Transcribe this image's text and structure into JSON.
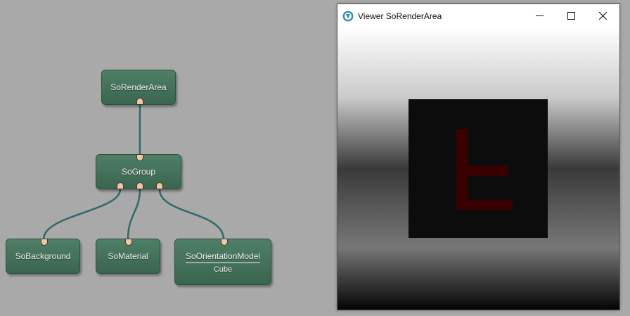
{
  "graph": {
    "nodes": {
      "render_area": {
        "label": "SoRenderArea"
      },
      "group": {
        "label": "SoGroup"
      },
      "background": {
        "label": "SoBackground"
      },
      "material": {
        "label": "SoMaterial"
      },
      "orientation_model": {
        "label": "SoOrientationModel",
        "sublabel": "Cube"
      }
    },
    "colors": {
      "node": "#44725b",
      "port": "#f3c79f",
      "wire": "#2e6a6a"
    }
  },
  "viewer": {
    "title": "Viewer SoRenderArea",
    "icons": {
      "app": "app-logo-icon",
      "minimize": "minimize-icon",
      "maximize": "maximize-icon",
      "close": "close-icon"
    },
    "colors": {
      "cube": "#0c0c0c",
      "letter": "#3a0000"
    }
  }
}
